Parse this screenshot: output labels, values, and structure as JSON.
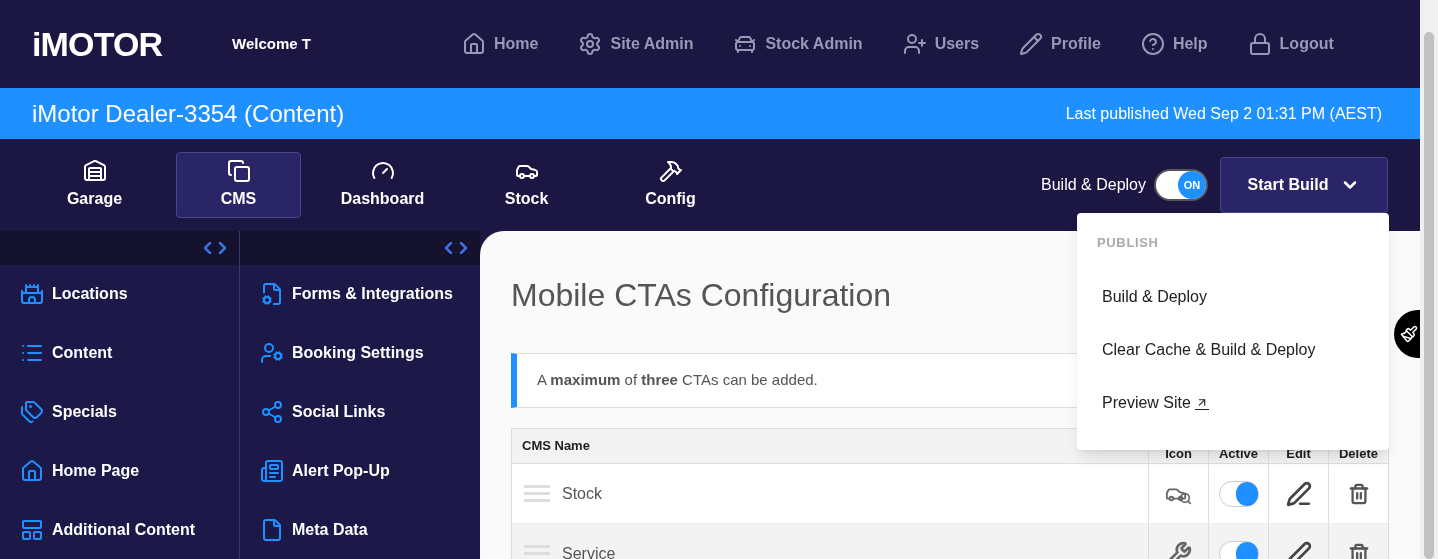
{
  "header": {
    "logo": "iMOTOR",
    "welcome": "Welcome T",
    "nav": [
      {
        "label": "Home"
      },
      {
        "label": "Site Admin"
      },
      {
        "label": "Stock Admin"
      },
      {
        "label": "Users"
      },
      {
        "label": "Profile"
      },
      {
        "label": "Help"
      },
      {
        "label": "Logout"
      }
    ]
  },
  "banner": {
    "title": "iMotor Dealer-3354 (Content)",
    "last_published": "Last published Wed Sep 2 01:31 PM (AEST)"
  },
  "tabs": [
    {
      "label": "Garage",
      "selected": false
    },
    {
      "label": "CMS",
      "selected": true
    },
    {
      "label": "Dashboard",
      "selected": false
    },
    {
      "label": "Stock",
      "selected": false
    },
    {
      "label": "Config",
      "selected": false
    }
  ],
  "build_toggle": {
    "label": "Build & Deploy",
    "on": true,
    "state_text": "ON"
  },
  "start_build": {
    "label": "Start Build",
    "expanded": true
  },
  "menu": {
    "heading": "PUBLISH",
    "items": [
      {
        "label": "Build & Deploy",
        "external": false
      },
      {
        "label": "Clear Cache & Build & Deploy",
        "external": false
      },
      {
        "label": "Preview Site",
        "external": true
      }
    ]
  },
  "sidebar_1": {
    "items": [
      {
        "label": "Locations"
      },
      {
        "label": "Content"
      },
      {
        "label": "Specials"
      },
      {
        "label": "Home Page"
      },
      {
        "label": "Additional Content"
      }
    ]
  },
  "sidebar_2": {
    "items": [
      {
        "label": "Forms & Integrations"
      },
      {
        "label": "Booking Settings"
      },
      {
        "label": "Social Links"
      },
      {
        "label": "Alert Pop-Up"
      },
      {
        "label": "Meta Data"
      }
    ]
  },
  "page": {
    "title": "Mobile CTAs Configuration",
    "notice": "A **maximum** of **three** CTAs can be added.",
    "table": {
      "columns": [
        "CMS Name",
        "Icon",
        "Active",
        "Edit",
        "Delete"
      ],
      "rows": [
        {
          "name": "Stock",
          "active": true
        },
        {
          "name": "Service",
          "active": true
        }
      ]
    }
  }
}
